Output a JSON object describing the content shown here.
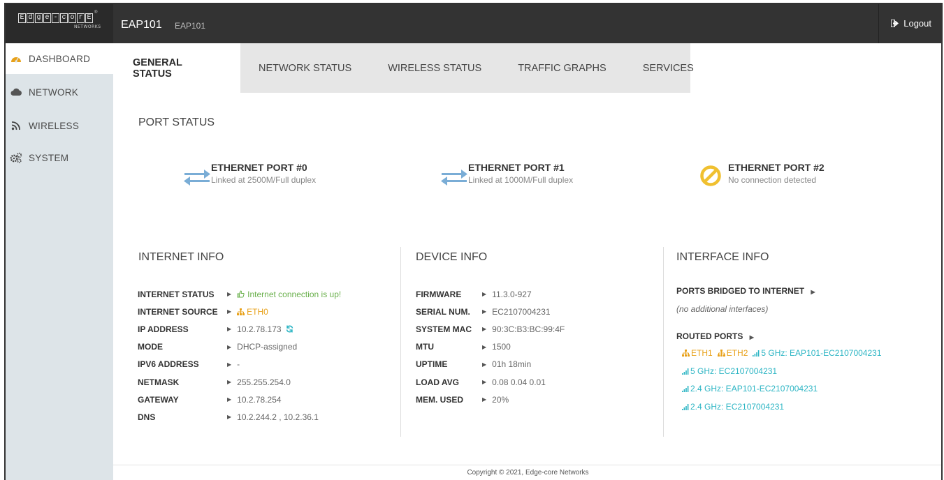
{
  "header": {
    "logo_letters": [
      "E",
      "d",
      "g",
      "e",
      "-",
      "c",
      "o",
      "r",
      "E"
    ],
    "logo_sub": "NETWORKS",
    "device_name": "EAP101",
    "device_sub": "EAP101",
    "logout_label": "Logout",
    "logout_icon": "sign-out-icon"
  },
  "sidebar": {
    "items": [
      {
        "label": "DASHBOARD",
        "icon": "dashboard-icon",
        "active": true
      },
      {
        "label": "NETWORK",
        "icon": "cloud-icon",
        "active": false
      },
      {
        "label": "WIRELESS",
        "icon": "wifi-icon",
        "active": false
      },
      {
        "label": "SYSTEM",
        "icon": "cogs-icon",
        "active": false
      }
    ]
  },
  "tabs": [
    {
      "label": "GENERAL STATUS",
      "active": true
    },
    {
      "label": "NETWORK STATUS",
      "active": false
    },
    {
      "label": "WIRELESS STATUS",
      "active": false
    },
    {
      "label": "TRAFFIC GRAPHS",
      "active": false
    },
    {
      "label": "SERVICES",
      "active": false
    }
  ],
  "port_status": {
    "title": "PORT STATUS",
    "ports": [
      {
        "name": "ETHERNET PORT #0",
        "status": "Linked at 2500M/Full duplex",
        "state": "linked"
      },
      {
        "name": "ETHERNET PORT #1",
        "status": "Linked at 1000M/Full duplex",
        "state": "linked"
      },
      {
        "name": "ETHERNET PORT #2",
        "status": "No connection detected",
        "state": "down"
      }
    ]
  },
  "internet_info": {
    "title": "INTERNET INFO",
    "rows": [
      {
        "key": "INTERNET STATUS",
        "value": "Internet connection is up!"
      },
      {
        "key": "INTERNET SOURCE",
        "value": "ETH0"
      },
      {
        "key": "IP ADDRESS",
        "value": "10.2.78.173"
      },
      {
        "key": "MODE",
        "value": "DHCP-assigned"
      },
      {
        "key": "IPV6 ADDRESS",
        "value": "-"
      },
      {
        "key": "NETMASK",
        "value": "255.255.254.0"
      },
      {
        "key": "GATEWAY",
        "value": "10.2.78.254"
      },
      {
        "key": "DNS",
        "value": "10.2.244.2 , 10.2.36.1"
      }
    ]
  },
  "device_info": {
    "title": "DEVICE INFO",
    "rows": [
      {
        "key": "FIRMWARE",
        "value": "11.3.0-927"
      },
      {
        "key": "SERIAL NUM.",
        "value": "EC2107004231"
      },
      {
        "key": "SYSTEM MAC",
        "value": "90:3C:B3:BC:99:4F"
      },
      {
        "key": "MTU",
        "value": "1500"
      },
      {
        "key": "UPTIME",
        "value": "01h 18min"
      },
      {
        "key": "LOAD AVG",
        "value": "0.08 0.04 0.01"
      },
      {
        "key": "MEM. USED",
        "value": "20%"
      }
    ]
  },
  "interface_info": {
    "title": "INTERFACE INFO",
    "bridged_label": "PORTS BRIDGED TO INTERNET",
    "bridged_value": "(no additional interfaces)",
    "routed_label": "ROUTED PORTS",
    "routed": {
      "eth1": "ETH1",
      "eth2": "ETH2",
      "wifi": [
        "5 GHz: EAP101-EC2107004231",
        "5 GHz: EC2107004231",
        "2.4 GHz: EAP101-EC2107004231",
        "2.4 GHz: EC2107004231"
      ]
    }
  },
  "footer": {
    "copyright": "Copyright © 2021, Edge-core Networks"
  },
  "colors": {
    "topbar": "#333333",
    "sidebar": "#dde4e8",
    "tab_strip": "#e6e6e6",
    "link_arrow": "#7aadd6",
    "warning": "#f0c030",
    "success": "#6ab04c",
    "teal": "#2cb5c4",
    "orange": "#e8a11a"
  }
}
